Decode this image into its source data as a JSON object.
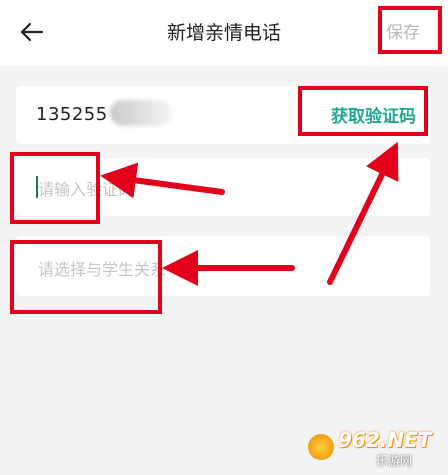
{
  "header": {
    "title": "新增亲情电话",
    "save_label": "保存"
  },
  "phone_row": {
    "number_visible": "135255",
    "get_code_label": "获取验证码"
  },
  "code_input": {
    "placeholder": "请输入验证码"
  },
  "relation_select": {
    "placeholder": "请选择与学生关系"
  },
  "watermark": {
    "brand": "962.NET",
    "sub": "乐游网"
  },
  "colors": {
    "accent": "#22a593",
    "annotation_red": "#e3001b",
    "background": "#f3f3f5"
  }
}
